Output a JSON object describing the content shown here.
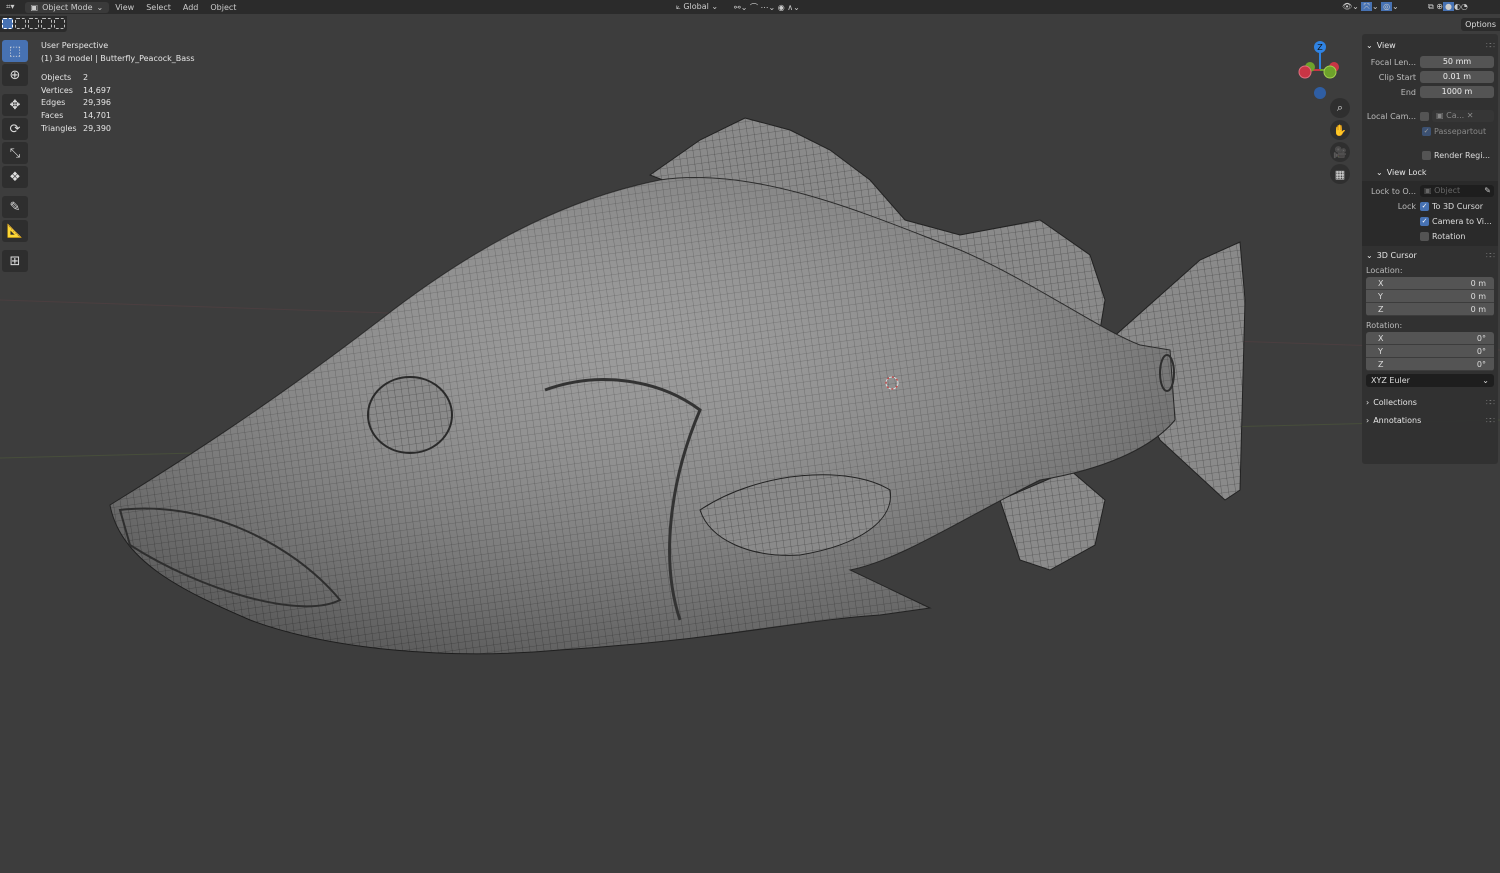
{
  "header": {
    "mode": "Object Mode",
    "menus": [
      "View",
      "Select",
      "Add",
      "Object"
    ],
    "orientation": "Global",
    "options": "Options"
  },
  "overlay": {
    "view_name": "User Perspective",
    "object_line": "(1) 3d model | Butterfly_Peacock_Bass",
    "stats": [
      {
        "label": "Objects",
        "value": "2"
      },
      {
        "label": "Vertices",
        "value": "14,697"
      },
      {
        "label": "Edges",
        "value": "29,396"
      },
      {
        "label": "Faces",
        "value": "14,701"
      },
      {
        "label": "Triangles",
        "value": "29,390"
      }
    ]
  },
  "gizmo": {
    "z": "Z",
    "y": "Y",
    "x": "X",
    "colors": {
      "x": "#c93545",
      "y": "#6ea22b",
      "z": "#2f83e3"
    }
  },
  "npanel": {
    "view": {
      "title": "View",
      "focal_label": "Focal Len...",
      "focal": "50 mm",
      "clip_start_label": "Clip Start",
      "clip_start": "0.01 m",
      "end_label": "End",
      "end": "1000 m",
      "local_cam_label": "Local Cam...",
      "local_cam_value": "Ca...",
      "passepartout": "Passepartout",
      "render_region": "Render Regi..."
    },
    "view_lock": {
      "title": "View Lock",
      "lock_to_label": "Lock to O...",
      "lock_to_placeholder": "Object",
      "lock_label": "Lock",
      "to_cursor": "To 3D Cursor",
      "camera_to_view": "Camera to Vi...",
      "rotation": "Rotation"
    },
    "cursor": {
      "title": "3D Cursor",
      "location_label": "Location:",
      "location": [
        {
          "axis": "X",
          "value": "0 m"
        },
        {
          "axis": "Y",
          "value": "0 m"
        },
        {
          "axis": "Z",
          "value": "0 m"
        }
      ],
      "rotation_label": "Rotation:",
      "rotation": [
        {
          "axis": "X",
          "value": "0°"
        },
        {
          "axis": "Y",
          "value": "0°"
        },
        {
          "axis": "Z",
          "value": "0°"
        }
      ],
      "rotation_mode": "XYZ Euler"
    },
    "collections": "Collections",
    "annotations": "Annotations"
  },
  "accent": "#4772b3"
}
